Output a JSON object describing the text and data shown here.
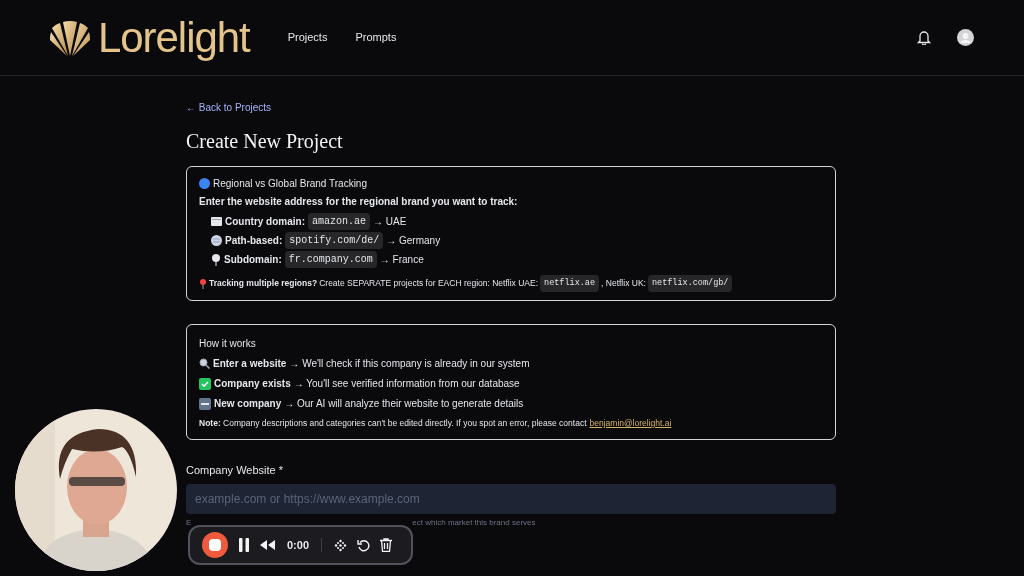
{
  "header": {
    "brand": "Lorelight",
    "nav": [
      {
        "label": "Projects"
      },
      {
        "label": "Prompts"
      }
    ]
  },
  "back_link": "← Back to Projects",
  "title": "Create New Project",
  "regional_box": {
    "heading": "Regional vs Global Brand Tracking",
    "intro": "Enter the website address for the regional brand you want to track:",
    "examples": [
      {
        "label": "Country domain:",
        "code": "amazon.ae",
        "result": "→ UAE"
      },
      {
        "label": "Path-based:",
        "code": "spotify.com/de/",
        "result": "→ Germany"
      },
      {
        "label": "Subdomain:",
        "code": "fr.company.com",
        "result": "→ France"
      }
    ],
    "tip": {
      "bold": "Tracking multiple regions?",
      "text": "Create SEPARATE projects for EACH region: Netflix UAE:",
      "code1": "netflix.ae",
      "mid": ", Netflix UK:",
      "code2": "netflix.com/gb/"
    }
  },
  "how_box": {
    "heading": "How it works",
    "steps": [
      {
        "bold": "Enter a website",
        "text": "→ We'll check if this company is already in our system"
      },
      {
        "bold": "Company exists",
        "text": "→ You'll see verified information from our database"
      },
      {
        "bold": "New company",
        "text": "→ Our AI will analyze their website to generate details"
      }
    ],
    "note": {
      "text": "**Note:** Company descriptions and categories can't be edited directly. If you spot an error, please contact",
      "email": "benjamin@lorelight.ai"
    }
  },
  "website_field": {
    "label": "Company Website *",
    "placeholder": "example.com or https://www.example.com",
    "hint_start": "E",
    "hint_end": "ect which market this brand serves"
  },
  "recorder": {
    "time": "0:00"
  }
}
